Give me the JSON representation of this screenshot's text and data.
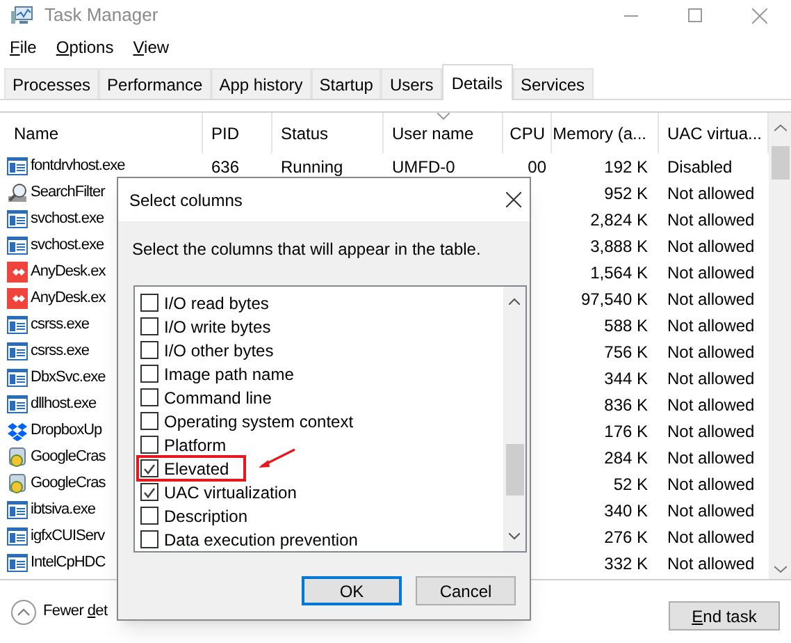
{
  "window": {
    "title": "Task Manager"
  },
  "menu": [
    "File",
    "Options",
    "View"
  ],
  "tabs": [
    {
      "label": "Processes",
      "selected": false
    },
    {
      "label": "Performance",
      "selected": false
    },
    {
      "label": "App history",
      "selected": false
    },
    {
      "label": "Startup",
      "selected": false
    },
    {
      "label": "Users",
      "selected": false
    },
    {
      "label": "Details",
      "selected": true
    },
    {
      "label": "Services",
      "selected": false
    }
  ],
  "table": {
    "columns": [
      {
        "label": "Name",
        "sorted": false
      },
      {
        "label": "PID",
        "sorted": false
      },
      {
        "label": "Status",
        "sorted": false
      },
      {
        "label": "User name",
        "sorted": true
      },
      {
        "label": "CPU",
        "sorted": false
      },
      {
        "label": "Memory (a...",
        "sorted": false
      },
      {
        "label": "UAC virtua...",
        "sorted": false
      }
    ],
    "rows": [
      {
        "kind": "window",
        "name": "fontdrvhost.exe",
        "pid": "636",
        "status": "Running",
        "user": "UMFD-0",
        "cpu": "00",
        "memory": "192 K",
        "uac": "Disabled"
      },
      {
        "kind": "search",
        "name": "SearchFilter",
        "memory": "952 K",
        "uac": "Not allowed"
      },
      {
        "kind": "window",
        "name": "svchost.exe",
        "memory": "2,824 K",
        "uac": "Not allowed"
      },
      {
        "kind": "window",
        "name": "svchost.exe",
        "memory": "3,888 K",
        "uac": "Not allowed"
      },
      {
        "kind": "anydesk",
        "name": "AnyDesk.ex",
        "memory": "1,564 K",
        "uac": "Not allowed"
      },
      {
        "kind": "anydesk",
        "name": "AnyDesk.ex",
        "memory": "97,540 K",
        "uac": "Not allowed"
      },
      {
        "kind": "window",
        "name": "csrss.exe",
        "memory": "588 K",
        "uac": "Not allowed"
      },
      {
        "kind": "window",
        "name": "csrss.exe",
        "memory": "756 K",
        "uac": "Not allowed"
      },
      {
        "kind": "window",
        "name": "DbxSvc.exe",
        "memory": "344 K",
        "uac": "Not allowed"
      },
      {
        "kind": "window",
        "name": "dllhost.exe",
        "memory": "836 K",
        "uac": "Not allowed"
      },
      {
        "kind": "dropbox",
        "name": "DropboxUp",
        "memory": "176 K",
        "uac": "Not allowed"
      },
      {
        "kind": "installer",
        "name": "GoogleCras",
        "memory": "284 K",
        "uac": "Not allowed"
      },
      {
        "kind": "installer",
        "name": "GoogleCras",
        "memory": "52 K",
        "uac": "Not allowed"
      },
      {
        "kind": "window",
        "name": "ibtsiva.exe",
        "memory": "340 K",
        "uac": "Not allowed"
      },
      {
        "kind": "window",
        "name": "igfxCUIServ",
        "memory": "276 K",
        "uac": "Not allowed"
      },
      {
        "kind": "window",
        "name": "IntelCpHDC",
        "memory": "332 K",
        "uac": "Not allowed"
      }
    ]
  },
  "dialog": {
    "title": "Select columns",
    "instruction": "Select the columns that will appear in the table.",
    "items": [
      {
        "label": "I/O read bytes",
        "checked": false,
        "highlighted": false
      },
      {
        "label": "I/O write bytes",
        "checked": false,
        "highlighted": false
      },
      {
        "label": "I/O other bytes",
        "checked": false,
        "highlighted": false
      },
      {
        "label": "Image path name",
        "checked": false,
        "highlighted": false
      },
      {
        "label": "Command line",
        "checked": false,
        "highlighted": false
      },
      {
        "label": "Operating system context",
        "checked": false,
        "highlighted": false
      },
      {
        "label": "Platform",
        "checked": false,
        "highlighted": false
      },
      {
        "label": "Elevated",
        "checked": true,
        "highlighted": true
      },
      {
        "label": "UAC virtualization",
        "checked": true,
        "highlighted": false
      },
      {
        "label": "Description",
        "checked": false,
        "highlighted": false
      },
      {
        "label": "Data execution prevention",
        "checked": false,
        "highlighted": false
      }
    ],
    "buttons": [
      {
        "label": "OK",
        "default": true
      },
      {
        "label": "Cancel",
        "default": false
      }
    ]
  },
  "footer": {
    "fewer_details": "Fewer det",
    "end_task": "End task"
  }
}
